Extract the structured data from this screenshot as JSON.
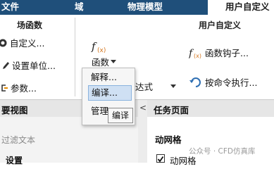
{
  "tabs": {
    "file": "文件",
    "domain": "域",
    "physics": "物理模型",
    "user": "用户自定义"
  },
  "ribbon": {
    "field_functions": {
      "title": "场函数",
      "define": "自定义...",
      "units": "设置单位...",
      "params": "参数..."
    },
    "user_defined": {
      "title": "用户自定义",
      "functions": "函数",
      "expressions": "约表达式",
      "hooks": "函数钩子...",
      "exec": "按命令执行..."
    }
  },
  "menu": {
    "explain": "解释...",
    "compile": "编译...",
    "manage": "管理"
  },
  "tooltip": "编译",
  "model_view": {
    "title": "要视图",
    "filter_placeholder": "过滤文本",
    "settings": "设置"
  },
  "task_page": {
    "title": "任务页面",
    "section": "动网格",
    "mesh_label": "动网格",
    "collapse_arrow": "<"
  },
  "watermark": "公众号 · CFD仿真库",
  "colors": {
    "tab_bar": "#1f4f7a",
    "menu_highlight": "#cfe0f3",
    "header_gray": "#e6e6e6"
  }
}
